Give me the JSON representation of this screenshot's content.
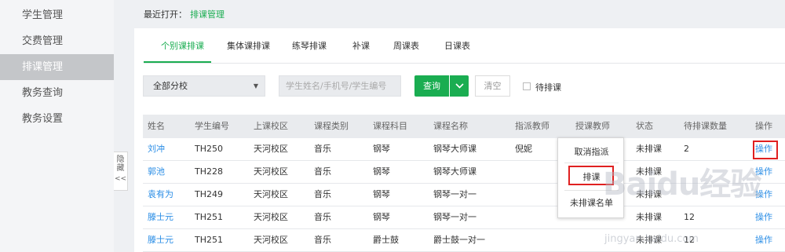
{
  "sidebar": {
    "items": [
      {
        "label": "学生管理"
      },
      {
        "label": "交费管理"
      },
      {
        "label": "排课管理",
        "active": true
      },
      {
        "label": "教务查询"
      },
      {
        "label": "教务设置"
      }
    ],
    "collapse_label": "隐藏",
    "collapse_arrows": "<<"
  },
  "recent": {
    "prefix": "最近打开：",
    "link": "排课管理"
  },
  "tabs": [
    {
      "label": "个别课排课",
      "active": true
    },
    {
      "label": "集体课排课"
    },
    {
      "label": "练琴排课"
    },
    {
      "label": "补课"
    },
    {
      "label": "周课表"
    },
    {
      "label": "日课表"
    }
  ],
  "filters": {
    "branch_value": "全部分校",
    "search_placeholder": "学生姓名/手机号/学生编号",
    "query_label": "查询",
    "clear_label": "清空",
    "pending_label": "待排课"
  },
  "table": {
    "headers": [
      "姓名",
      "学生编号",
      "上课校区",
      "课程类别",
      "课程科目",
      "课程名称",
      "指派教师",
      "授课教师",
      "状态",
      "待排课数量",
      "操作"
    ],
    "rows": [
      {
        "name": "刘冲",
        "id": "TH250",
        "campus": "天河校区",
        "category": "音乐",
        "subject": "钢琴",
        "course": "钢琴大师课",
        "assigned": "倪妮",
        "teacher": "",
        "status": "未排课",
        "pending": "2",
        "op": "操作"
      },
      {
        "name": "郭池",
        "id": "TH228",
        "campus": "天河校区",
        "category": "音乐",
        "subject": "钢琴",
        "course": "钢琴大师课",
        "assigned": "",
        "teacher": "",
        "status": "未排课",
        "pending": "",
        "op": "操作"
      },
      {
        "name": "袁有为",
        "id": "TH249",
        "campus": "天河校区",
        "category": "音乐",
        "subject": "钢琴",
        "course": "钢琴一对一",
        "assigned": "",
        "teacher": "",
        "status": "未排课",
        "pending": "",
        "op": "操作"
      },
      {
        "name": "滕士元",
        "id": "TH251",
        "campus": "天河校区",
        "category": "音乐",
        "subject": "钢琴",
        "course": "钢琴一对一",
        "assigned": "",
        "teacher": "",
        "status": "未排课",
        "pending": "12",
        "op": "操作"
      },
      {
        "name": "滕士元",
        "id": "TH251",
        "campus": "天河校区",
        "category": "音乐",
        "subject": "爵士鼓",
        "course": "爵士鼓一对一",
        "assigned": "",
        "teacher": "",
        "status": "未排课",
        "pending": "12",
        "op": "操作"
      }
    ]
  },
  "popup": {
    "cancel_assign": "取消指派",
    "schedule": "排课",
    "not_scheduled": "未排课名单"
  },
  "watermark": {
    "logo": "Baidu经验",
    "url": "jingyan.baidu.com"
  },
  "colors": {
    "accent": "#1aad51",
    "link": "#2b8ee6",
    "highlight": "#e02020"
  }
}
